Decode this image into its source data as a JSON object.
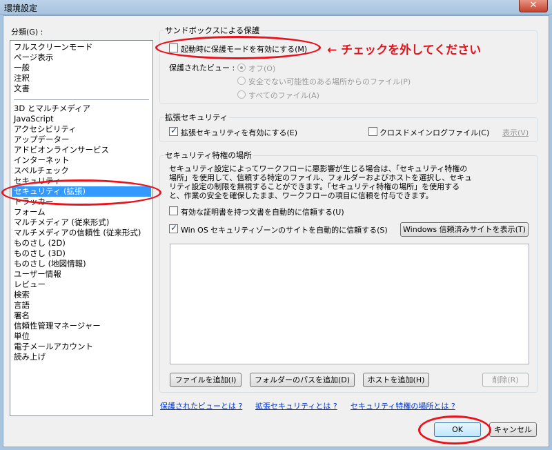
{
  "window": {
    "title": "環境設定",
    "close_glyph": "✕"
  },
  "categories": {
    "label": "分類(G) :",
    "group1": [
      "フルスクリーンモード",
      "ページ表示",
      "一般",
      "注釈",
      "文書"
    ],
    "group2": [
      "3D とマルチメディア",
      "JavaScript",
      "アクセシビリティ",
      "アップデーター",
      "アドビオンラインサービス",
      "インターネット",
      "スペルチェック",
      "セキュリティ",
      "セキュリティ (拡張)",
      "トラッカー",
      "フォーム",
      "マルチメディア (従来形式)",
      "マルチメディアの信頼性 (従来形式)",
      "ものさし (2D)",
      "ものさし (3D)",
      "ものさし (地図情報)",
      "ユーザー情報",
      "レビュー",
      "検索",
      "言語",
      "署名",
      "信頼性管理マネージャー",
      "単位",
      "電子メールアカウント",
      "読み上げ"
    ],
    "selected": "セキュリティ (拡張)"
  },
  "sandbox": {
    "title": "サンドボックスによる保護",
    "protected_mode_label": "起動時に保護モードを有効にする(M)",
    "protected_view_label": "保護されたビュー :",
    "options": [
      "オフ(O)",
      "安全でない可能性のある場所からのファイル(P)",
      "すべてのファイル(A)"
    ],
    "selected_option": "オフ(O)"
  },
  "enhanced": {
    "title": "拡張セキュリティ",
    "enable_label": "拡張セキュリティを有効にする(E)",
    "cross_domain_label": "クロスドメインログファイル(C)",
    "show_link": "表示(V)"
  },
  "privileged": {
    "title": "セキュリティ特権の場所",
    "desc_lines": [
      "セキュリティ設定によってワークフローに悪影響が生じる場合は、「セキュリティ特権の",
      "場所」を使用して、信頼する特定のファイル、フォルダーおよびホストを選択し、セキュ",
      "リティ設定の制限を無視することができます。「セキュリティ特権の場所」を使用する",
      "と、作業の安全を確保したまま、ワークフローの項目に信頼を付与できます。"
    ],
    "auto_trust_cert_label": "有効な証明書を持つ文書を自動的に信頼する(U)",
    "auto_trust_zone_label": "Win OS セキュリティゾーンのサイトを自動的に信頼する(S)",
    "show_trusted_sites_button": "Windows 信頼済みサイトを表示(T)",
    "add_file_button": "ファイルを追加(I)",
    "add_folder_button": "フォルダーのパスを追加(D)",
    "add_host_button": "ホストを追加(H)",
    "delete_button": "削除(R)"
  },
  "help_links": [
    "保護されたビューとは ?",
    "拡張セキュリティとは ?",
    "セキュリティ特権の場所とは ?"
  ],
  "footer": {
    "ok": "OK",
    "cancel": "キャンセル"
  },
  "annotation": {
    "text": "← チェックを外してください",
    "color": "#e8131c"
  },
  "state": {
    "protected_mode_checked": false,
    "enhanced_checked": true,
    "cross_domain_checked": false,
    "auto_trust_cert_checked": false,
    "auto_trust_zone_checked": true
  }
}
